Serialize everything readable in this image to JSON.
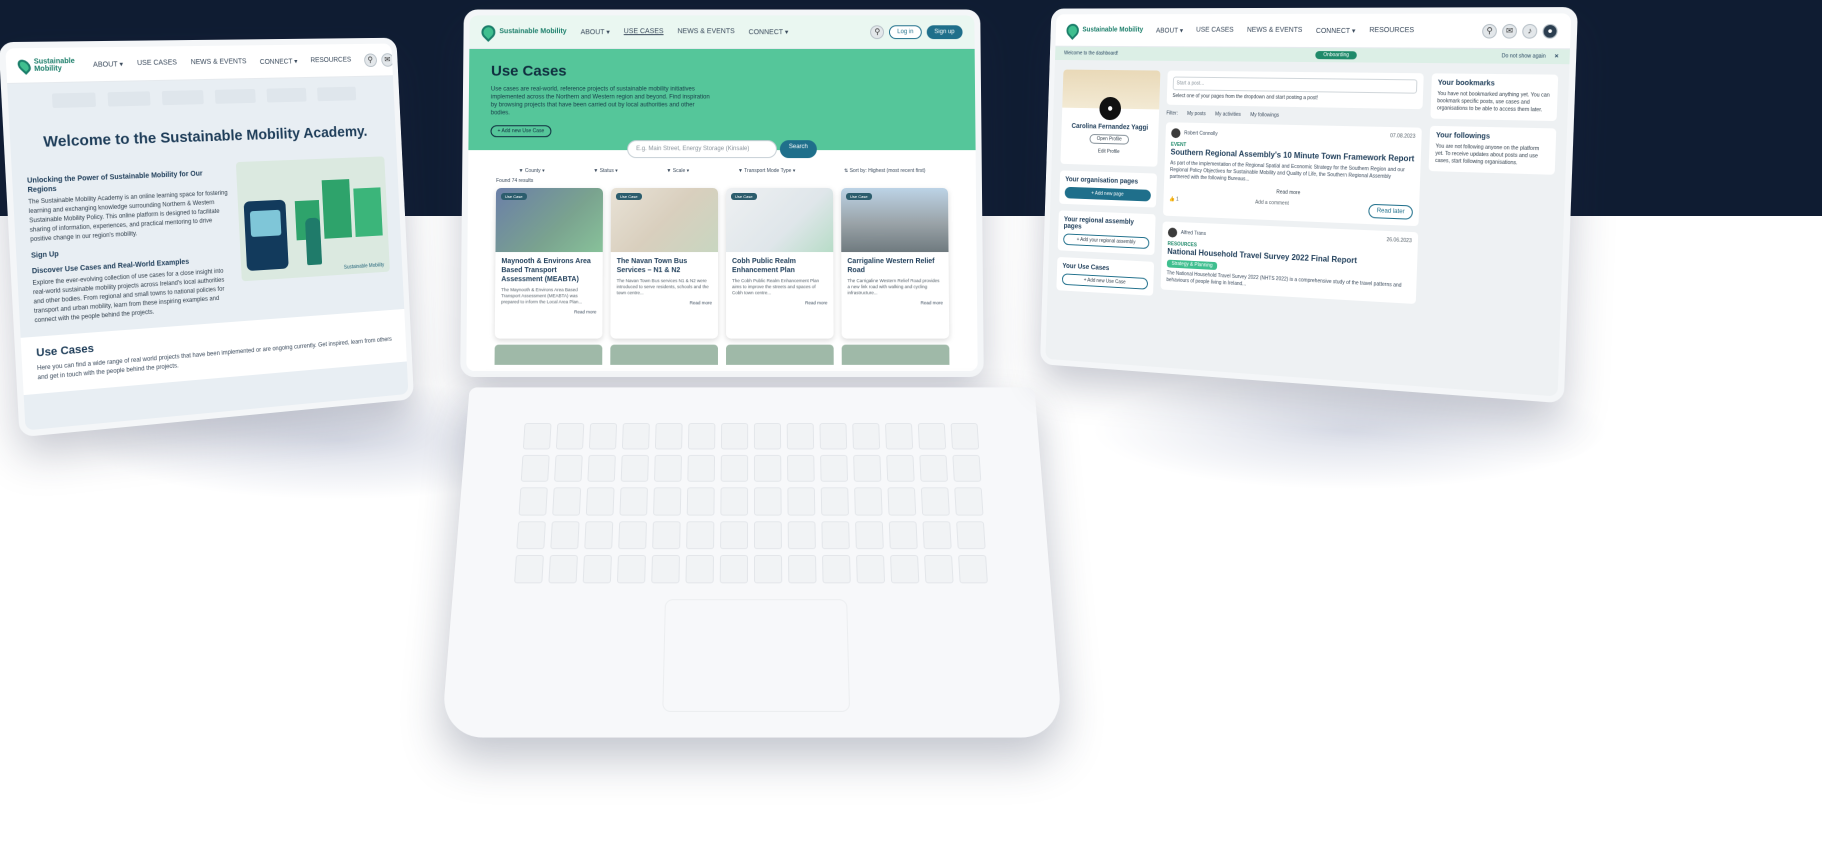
{
  "nav": {
    "logo": "Sustainable Mobility",
    "about": "ABOUT ▾",
    "use_cases": "USE CASES",
    "news_events": "NEWS & EVENTS",
    "connect": "CONNECT ▾",
    "resources": "RESOURCES",
    "login": "Log in",
    "signup": "Sign up"
  },
  "screen1": {
    "title": "Welcome to the Sustainable Mobility Academy.",
    "h_unlock": "Unlocking the Power of Sustainable Mobility for Our Regions",
    "p_unlock": "The Sustainable Mobility Academy is an online learning space for fostering learning and exchanging knowledge surrounding Northern & Western Sustainable Mobility Policy. This online platform is designed to facilitate sharing of information, experiences, and practical mentoring to drive positive change in our region's mobility.",
    "h_signup": "Sign Up",
    "h_discover": "Discover Use Cases and Real-World Examples",
    "p_discover": "Explore the ever-evolving collection of use cases for a close insight into real-world sustainable mobility projects across Ireland's local authorities and other bodies. From regional and small towns to national policies for transport and urban mobility, learn from these inspiring examples and connect with the people behind the projects.",
    "illus_caption": "Sustainable Mobility",
    "usecases_heading": "Use Cases",
    "usecases_text": "Here you can find a wide range of real world projects that have been implemented or are ongoing currently. Get inspired, learn from others and get in touch with the people behind the projects."
  },
  "screen2": {
    "title": "Use Cases",
    "intro": "Use cases are real-world, reference projects of sustainable mobility initiatives implemented across the Northern and Western region and beyond. Find inspiration by browsing projects that have been carried out by local authorities and other bodies.",
    "add_button": "+ Add new Use Case",
    "search_placeholder": "E.g. Main Street, Energy Storage (Kinsale)",
    "search_button": "Search",
    "filters": [
      "▼ County ▾",
      "▼ Status ▾",
      "▼ Scale ▾",
      "▼ Transport Mode Type ▾",
      "⇅ Sort by: Highest (most recent first)"
    ],
    "found": "Found 74 results",
    "cards": [
      {
        "tag": "Use Case",
        "title": "Maynooth & Environs Area Based Transport Assessment (MEABTA)",
        "text": "The Maynooth & Environs Area Based Transport Assessment (MEABTA) was prepared to inform the Local Area Plan...",
        "more": "Read more"
      },
      {
        "tag": "Use Case",
        "title": "The Navan Town Bus Services – N1 & N2",
        "text": "The Navan Town Bus services N1 & N2 were introduced to serve residents, schools and the town centre...",
        "more": "Read more"
      },
      {
        "tag": "Use Case",
        "title": "Cobh Public Realm Enhancement Plan",
        "text": "The Cobh Public Realm Enhancement Plan aims to improve the streets and spaces of Cobh town centre...",
        "more": "Read more"
      },
      {
        "tag": "Use Case",
        "title": "Carrigaline Western Relief Road",
        "text": "The Carrigaline Western Relief Road provides a new link road with walking and cycling infrastructure...",
        "more": "Read more"
      }
    ]
  },
  "screen3": {
    "welcome": "Welcome to the dashboard!",
    "onboarding": "Onboarding",
    "dismiss": "Do not show again",
    "profile": {
      "name": "Carolina Fernandez Yaggi",
      "open": "Open Profile",
      "edit": "Edit Profile"
    },
    "org_pages": "Your organisation pages",
    "add_page": "+ Add new page",
    "regional_pages": "Your regional assembly pages",
    "add_regional": "+ Add your regional assembly",
    "your_usecases": "Your Use Cases",
    "add_usecase": "+ Add new Use Case",
    "post_placeholder": "Start a post...",
    "post_hint": "Select one of your pages from the dropdown and start posting a post!",
    "feed_filters": [
      "Filter:",
      "My posts",
      "My activities",
      "My followings"
    ],
    "post1": {
      "author": "Robert Connolly",
      "date": "07.08.2023",
      "kind": "EVENT",
      "title": "Southern Regional Assembly's 10 Minute Town Framework Report",
      "text": "As part of the implementation of the Regional Spatial and Economic Strategy for the Southern Region and our Regional Policy Objectives for Sustainable Mobility and Quality of Life, the Southern Regional Assembly partnered with the following Bureaus...",
      "read_more": "Read more",
      "add_comment": "Add a comment",
      "likes": "1",
      "read_later": "Read later"
    },
    "post2": {
      "author": "Alfred Trans",
      "date": "26.06.2023",
      "kind": "RESOURCES",
      "title": "National Household Travel Survey 2022 Final Report",
      "chip": "Strategy & Planning",
      "text": "The National Household Travel Survey 2022 (NHTS 2022) is a comprehensive study of the travel patterns and behaviours of people living in Ireland..."
    },
    "bookmarks": {
      "title": "Your bookmarks",
      "text": "You have not bookmarked anything yet. You can bookmark specific posts, use cases and organisations to be able to access them later."
    },
    "followings": {
      "title": "Your followings",
      "text": "You are not following anyone on the platform yet. To receive updates about posts and use cases, start following organisations."
    }
  },
  "colors": {
    "navy": "#0f1c32",
    "brand_green": "#55c69a",
    "brand_teal": "#1f6f8b"
  }
}
